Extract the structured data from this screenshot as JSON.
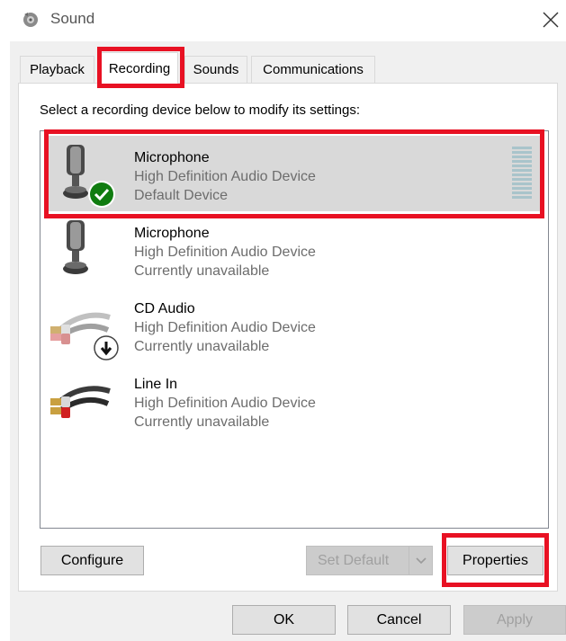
{
  "window": {
    "title": "Sound",
    "icon": "speaker-icon",
    "close_icon": "close-icon"
  },
  "tabs": [
    {
      "label": "Playback",
      "active": false
    },
    {
      "label": "Recording",
      "active": true
    },
    {
      "label": "Sounds",
      "active": false
    },
    {
      "label": "Communications",
      "active": false
    }
  ],
  "instruction": "Select a recording device below to modify its settings:",
  "devices": [
    {
      "name": "Microphone",
      "description": "High Definition Audio Device",
      "status": "Default Device",
      "icon": "microphone-icon",
      "badge": "check-badge-icon",
      "selected": true
    },
    {
      "name": "Microphone",
      "description": "High Definition Audio Device",
      "status": "Currently unavailable",
      "icon": "microphone-icon",
      "selected": false
    },
    {
      "name": "CD Audio",
      "description": "High Definition Audio Device",
      "status": "Currently unavailable",
      "icon": "audio-cable-icon",
      "badge": "down-arrow-badge-icon",
      "selected": false
    },
    {
      "name": "Line In",
      "description": "High Definition Audio Device",
      "status": "Currently unavailable",
      "icon": "audio-cable-icon",
      "selected": false
    }
  ],
  "buttons": {
    "configure": "Configure",
    "set_default": "Set Default",
    "properties": "Properties",
    "ok": "OK",
    "cancel": "Cancel",
    "apply": "Apply"
  },
  "colors": {
    "highlight": "#e81123",
    "selected_row": "#d9d9d9",
    "check_badge": "#107c10",
    "level_meter": "#a9c4cb"
  }
}
